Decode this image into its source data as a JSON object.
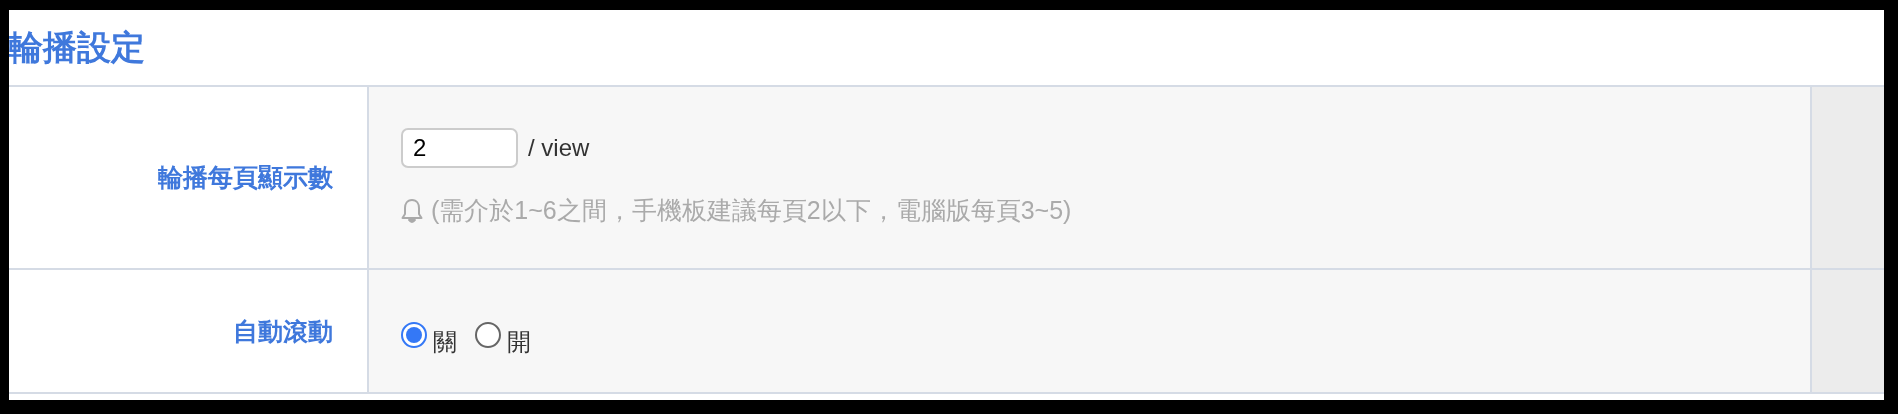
{
  "title": "輪播設定",
  "rows": [
    {
      "kind": "number",
      "label": "輪播每頁顯示數",
      "value": "2",
      "unit": "/ view",
      "hint": "(需介於1~6之間，手機板建議每頁2以下，電腦版每頁3~5)"
    },
    {
      "kind": "radio",
      "label": "自動滾動",
      "options": [
        {
          "label": "關",
          "selected": true
        },
        {
          "label": "開",
          "selected": false
        }
      ]
    }
  ]
}
